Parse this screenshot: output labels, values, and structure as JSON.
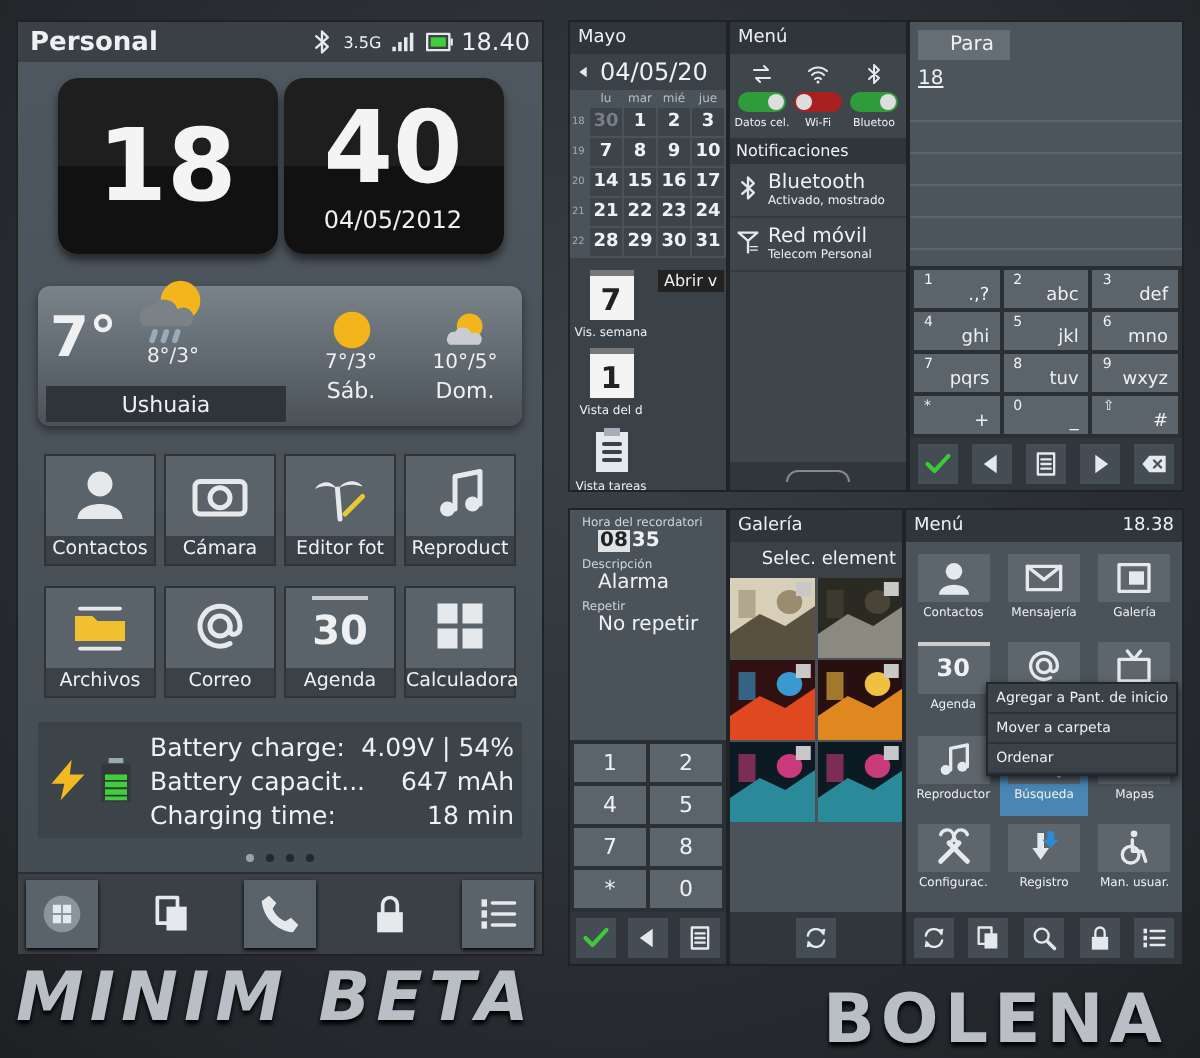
{
  "home": {
    "status": {
      "carrier": "Personal",
      "network": "3.5G",
      "time": "18.40"
    },
    "clock": {
      "hour": "18",
      "minute": "40",
      "date": "04/05/2012"
    },
    "weather": {
      "temp": "7°",
      "today": "8°/3°",
      "city": "Ushuaia",
      "forecast": [
        {
          "temp": "7°/3°",
          "day": "Sáb."
        },
        {
          "temp": "10°/5°",
          "day": "Dom."
        }
      ]
    },
    "apps": [
      {
        "label": "Contactos"
      },
      {
        "label": "Cámara"
      },
      {
        "label": "Editor fot"
      },
      {
        "label": "Reproduct"
      },
      {
        "label": "Archivos"
      },
      {
        "label": "Correo"
      },
      {
        "label": "Agenda",
        "icon_text": "30"
      },
      {
        "label": "Calculadora"
      }
    ],
    "battery": [
      {
        "label": "Battery charge:",
        "value": "4.09V | 54%"
      },
      {
        "label": "Battery capacit...",
        "value": "647 mAh"
      },
      {
        "label": "Charging time:",
        "value": "18 min"
      }
    ],
    "page_dots": [
      {
        "selected": true
      },
      {
        "selected": false
      },
      {
        "selected": false
      },
      {
        "selected": false
      }
    ]
  },
  "calendar": {
    "month": "Mayo",
    "date": "04/05/20",
    "weekdays": [
      "lu",
      "mar",
      "mié",
      "jue"
    ],
    "weeks": [
      {
        "number": "18",
        "days": [
          {
            "day": "30",
            "other_month": true
          },
          {
            "day": "1",
            "other_month": false
          },
          {
            "day": "2",
            "other_month": false
          },
          {
            "day": "3",
            "other_month": false
          }
        ]
      },
      {
        "number": "19",
        "days": [
          {
            "day": "7",
            "other_month": false
          },
          {
            "day": "8",
            "other_month": false
          },
          {
            "day": "9",
            "other_month": false
          },
          {
            "day": "10",
            "other_month": false
          }
        ]
      },
      {
        "number": "20",
        "days": [
          {
            "day": "14",
            "other_month": false
          },
          {
            "day": "15",
            "other_month": false
          },
          {
            "day": "16",
            "other_month": false
          },
          {
            "day": "17",
            "other_month": false
          }
        ]
      },
      {
        "number": "21",
        "days": [
          {
            "day": "21",
            "other_month": false
          },
          {
            "day": "22",
            "other_month": false
          },
          {
            "day": "23",
            "other_month": false
          },
          {
            "day": "24",
            "other_month": false
          }
        ]
      },
      {
        "number": "22",
        "days": [
          {
            "day": "28",
            "other_month": false
          },
          {
            "day": "29",
            "other_month": false
          },
          {
            "day": "30",
            "other_month": false
          },
          {
            "day": "31",
            "other_month": false
          }
        ]
      }
    ],
    "tooltip": "Abrir v",
    "views": [
      {
        "kind": "page",
        "icon_text": "7",
        "label": "Vis. semana"
      },
      {
        "kind": "page",
        "icon_text": "1",
        "label": "Vista del d"
      },
      {
        "kind": "tasks",
        "label": "Vista tareas"
      }
    ]
  },
  "quick_menu": {
    "title": "Menú",
    "toggles": [
      {
        "label": "Datos cel.",
        "on": true
      },
      {
        "label": "Wi-Fi",
        "on": false
      },
      {
        "label": "Bluetoo",
        "on": true
      }
    ],
    "section": "Notificaciones",
    "notifications": [
      {
        "title": "Bluetooth",
        "detail": "Activado, mostrado"
      },
      {
        "title": "Red móvil",
        "detail": "Telecom Personal"
      }
    ]
  },
  "message": {
    "recipient_label": "Para",
    "text": "18",
    "keys": [
      {
        "digit": "1",
        "letters": ".,?"
      },
      {
        "digit": "2",
        "letters": "abc"
      },
      {
        "digit": "3",
        "letters": "def"
      },
      {
        "digit": "4",
        "letters": "ghi"
      },
      {
        "digit": "5",
        "letters": "jkl"
      },
      {
        "digit": "6",
        "letters": "mno"
      },
      {
        "digit": "7",
        "letters": "pqrs"
      },
      {
        "digit": "8",
        "letters": "tuv"
      },
      {
        "digit": "9",
        "letters": "wxyz"
      },
      {
        "digit": "*",
        "letters": "+"
      },
      {
        "digit": "0",
        "letters": "_"
      },
      {
        "digit": "⇧",
        "letters": "#"
      }
    ]
  },
  "reminder": {
    "time_label": "Hora del recordatori",
    "hour": "08",
    "hour_focused": true,
    "minute": "35",
    "desc_label": "Descripción",
    "desc": "Alarma",
    "repeat_label": "Repetir",
    "repeat": "No repetir",
    "keys": [
      "1",
      "2",
      "4",
      "5",
      "7",
      "8",
      "*",
      "0"
    ]
  },
  "gallery": {
    "title": "Galería",
    "header": "Selec. element"
  },
  "app_menu": {
    "title": "Menú",
    "time": "18.38",
    "items": [
      {
        "label": "Contactos",
        "selected": false
      },
      {
        "label": "Mensajería",
        "selected": false
      },
      {
        "label": "Galería",
        "selected": false
      },
      {
        "label": "Agenda",
        "icon_text": "30",
        "selected": false
      },
      {
        "selected": false
      },
      {
        "selected": false
      },
      {
        "label": "Reproductor",
        "selected": false
      },
      {
        "label": "Búsqueda",
        "selected": true
      },
      {
        "label": "Mapas",
        "selected": false
      },
      {
        "label": "Configurac.",
        "selected": false
      },
      {
        "label": "Registro",
        "selected": false
      },
      {
        "label": "Man. usuar.",
        "selected": false
      }
    ],
    "context_menu": [
      "Agregar a Pant. de inicio",
      "Mover a carpeta",
      "Ordenar"
    ]
  },
  "banner": {
    "left": "MINIM BETA",
    "right": "BOLENA"
  }
}
